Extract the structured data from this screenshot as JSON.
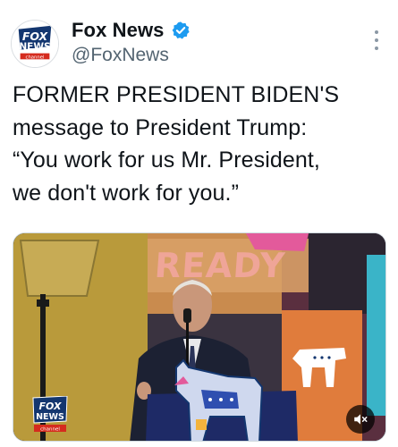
{
  "post": {
    "author": {
      "display_name": "Fox News",
      "handle": "@FoxNews",
      "verified": true,
      "avatar": {
        "icon": "fox-news-logo-icon",
        "logo_text_top": "FOX",
        "logo_text_bottom": "NEWS",
        "logo_text_small": "channel"
      }
    },
    "more_icon": "more-options-icon",
    "text_lines": [
      "FORMER PRESIDENT BIDEN'S",
      "message to President Trump:",
      "“You work for us Mr. President,",
      "we don't work for you.”"
    ],
    "media": {
      "type": "video",
      "background_sign_text": "READY",
      "watermark": {
        "top": "FOX",
        "bottom": "NEWS",
        "small": "channel"
      },
      "mute_icon": "speaker-muted-icon"
    }
  },
  "colors": {
    "verified_blue": "#1d9bf0",
    "text_primary": "#0f1419",
    "text_secondary": "#536471",
    "fox_blue": "#13366f",
    "fox_red": "#d52b1e"
  }
}
